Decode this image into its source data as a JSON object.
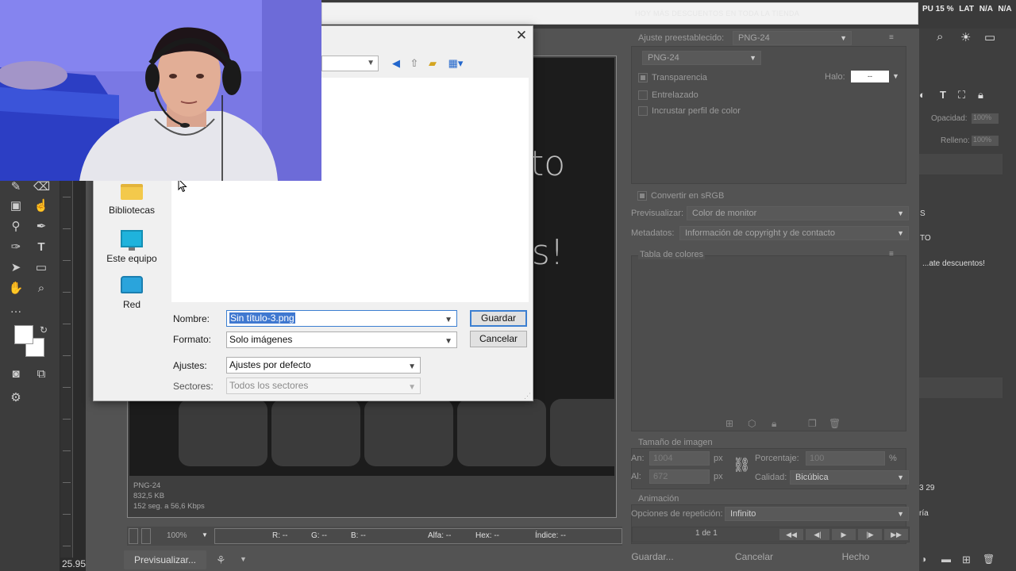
{
  "topbar": {
    "faded_text": "HOY MÁS DESCUENTOS EN TODA LA TIENDA",
    "sys": [
      "PU 15 %",
      "LAT",
      "N/A",
      "N/A"
    ]
  },
  "canvas": {
    "text_1": "esto",
    "text_2": "os!"
  },
  "preview_info": {
    "format": "PNG-24",
    "size": "832,5 KB",
    "speed": "152 seg. a 56,6 Kbps"
  },
  "statusbar": {
    "zoom": "100%",
    "r": "R: --",
    "g": "G: --",
    "b": "B: --",
    "alpha": "Alfa: --",
    "hex": "Hex: --",
    "index": "Índice: --"
  },
  "bottom_buttons": {
    "preview": "Previsualizar...",
    "save": "Guardar...",
    "cancel": "Cancelar",
    "done": "Hecho"
  },
  "settings": {
    "preset_label": "Ajuste preestablecido:",
    "preset_value": "PNG-24",
    "format_value": "PNG-24",
    "transparency": "Transparencia",
    "halo": "Halo:",
    "halo_value": "--",
    "interlaced": "Entrelazado",
    "embed_profile": "Incrustar perfil de color",
    "convert_srgb": "Convertir en sRGB",
    "preview_label": "Previsualizar:",
    "preview_value": "Color de monitor",
    "metadata_label": "Metadatos:",
    "metadata_value": "Información de copyright y de contacto",
    "color_table": "Tabla de colores",
    "image_size": "Tamaño de imagen",
    "width_label": "An:",
    "width_value": "1004",
    "height_label": "Al:",
    "height_value": "672",
    "unit": "px",
    "percent_label": "Porcentaje:",
    "percent_value": "100",
    "percent_sign": "%",
    "quality_label": "Calidad:",
    "quality_value": "Bicúbica",
    "animation": "Animación",
    "loop_label": "Opciones de repetición:",
    "loop_value": "Infinito",
    "frame": "1 de 1"
  },
  "layers": {
    "opacity_label": "Opacidad:",
    "opacity_value": "100%",
    "fill_label": "Relleno:",
    "fill_value": "100%",
    "item_1": "S",
    "item_2": "TO",
    "item_3": "...ate descuentos!",
    "item_4": "3 29",
    "item_5": "ría"
  },
  "dialog": {
    "places": [
      "Bibliotecas",
      "Este equipo",
      "Red"
    ],
    "name_label": "Nombre:",
    "name_value": "Sin título-3.png",
    "format_label": "Formato:",
    "format_value": "Solo imágenes",
    "settings_label": "Ajustes:",
    "settings_value": "Ajustes por defecto",
    "slices_label": "Sectores:",
    "slices_value": "Todos los sectores",
    "save": "Guardar",
    "cancel": "Cancelar"
  },
  "toolbar": {
    "coord": "25.95"
  },
  "colors": {
    "selection": "#3f78d0",
    "panel": "#535353",
    "dialog": "#f0f0f0"
  }
}
